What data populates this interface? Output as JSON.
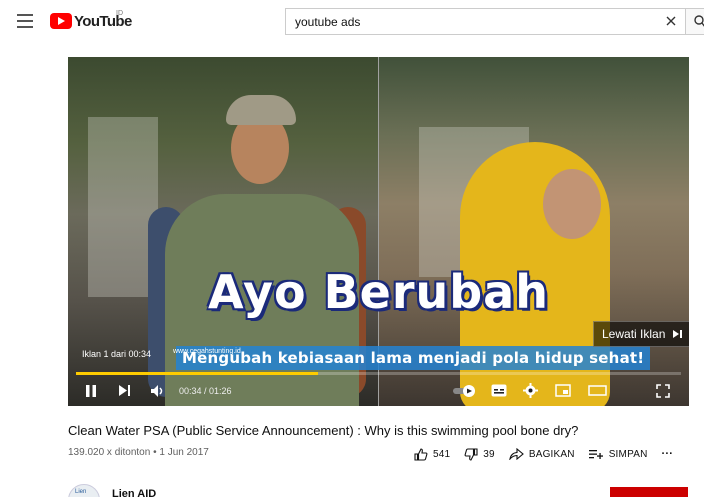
{
  "header": {
    "logo_text": "YouTube",
    "country_code": "ID",
    "search_value": "youtube ads"
  },
  "player": {
    "headline": "Ayo Berubah",
    "subtitle": "Mengubah kebiasaan lama menjadi pola hidup sehat!",
    "site_url": "www.cegahstunting.id",
    "ad_info": "Iklan 1 dari 00:34",
    "skip_label": "Lewati Iklan",
    "time_display": "00:34 / 01:26",
    "progress_fraction": 0.4,
    "accent_color": "#ffcc00"
  },
  "video": {
    "title": "Clean Water PSA (Public Service Announcement) : Why is this swimming pool bone dry?",
    "views": "139.020 x ditonton",
    "date": "1 Jun 2017",
    "meta_separator": " • ",
    "likes": "541",
    "dislikes": "39",
    "share_label": "BAGIKAN",
    "save_label": "SIMPAN",
    "more_label": "···"
  },
  "channel": {
    "name": "Lien AID",
    "avatar_text": "Lien"
  }
}
